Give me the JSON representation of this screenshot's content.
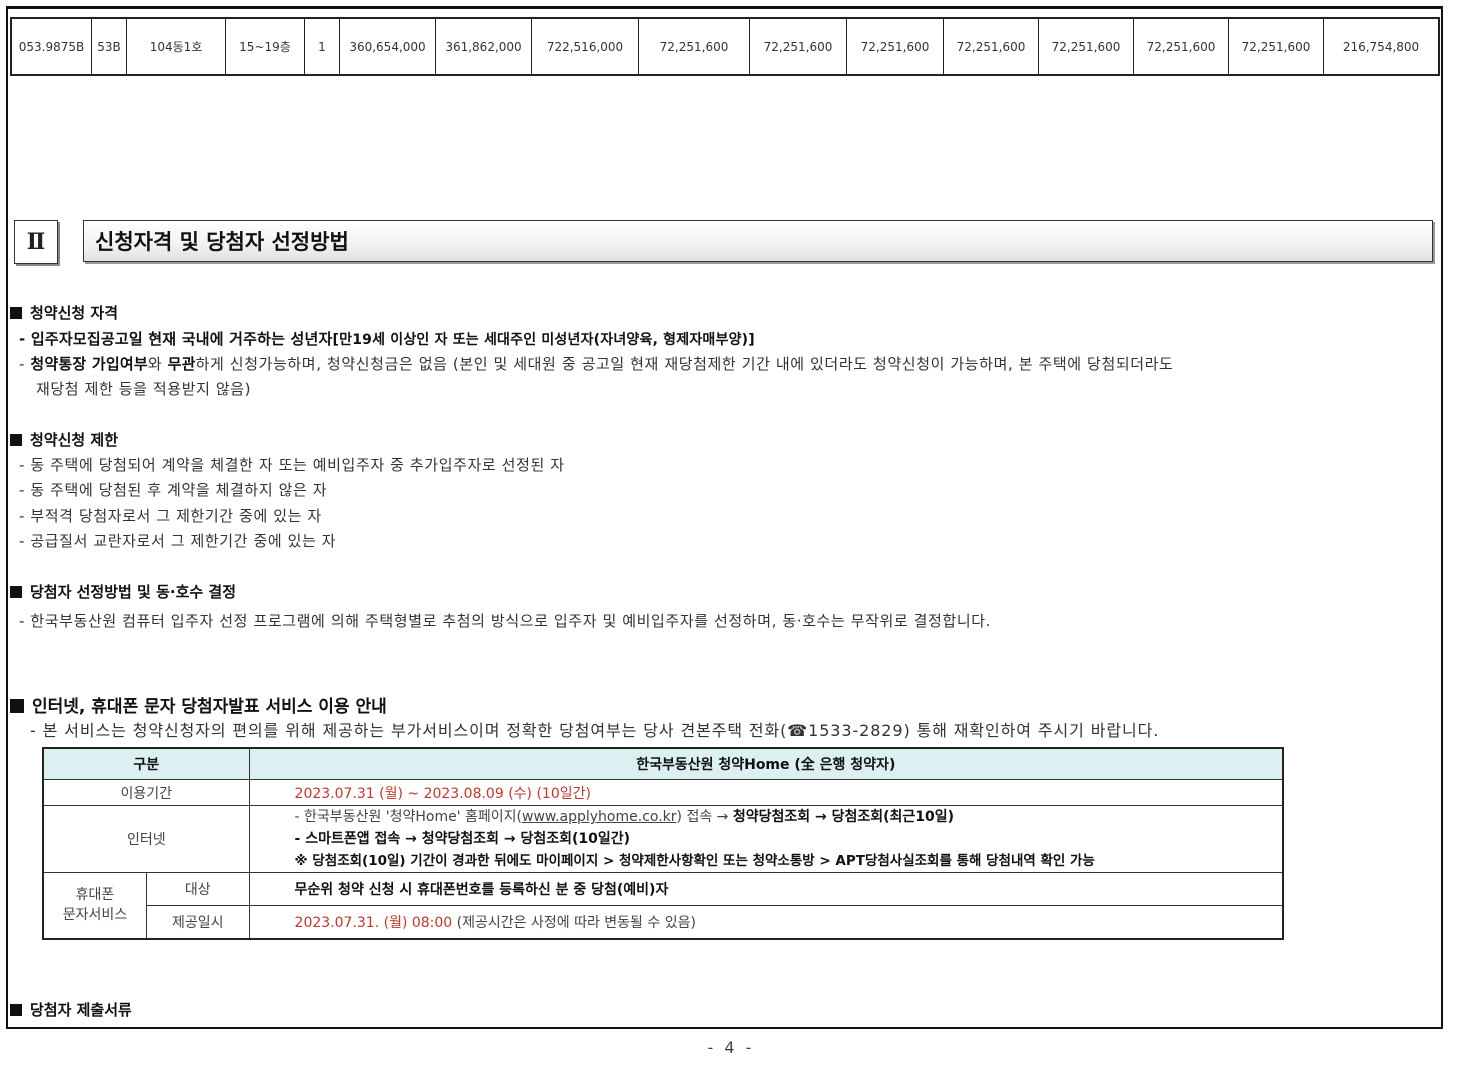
{
  "price_row": [
    "053.9875B",
    "53B",
    "104동1호",
    "15~19층",
    "1",
    "360,654,000",
    "361,862,000",
    "722,516,000",
    "72,251,600",
    "72,251,600",
    "72,251,600",
    "72,251,600",
    "72,251,600",
    "72,251,600",
    "72,251,600",
    "216,754,800"
  ],
  "section": {
    "number": "Ⅱ",
    "title": "신청자격 및 당첨자 선정방법"
  },
  "qualification": {
    "heading": "청약신청 자격",
    "line1_bold": "- 입주자모집공고일 현재 국내에 거주하는 성년자",
    "line1_rest": "[만19세 이상인 자 또는 세대주인 미성년자(자녀양육, 형제자매부양)]",
    "line2_bold_a": "청약통장 가입여부",
    "line2_mid": "와 ",
    "line2_bold_b": "무관",
    "line2_rest": "하게 신청가능하며, 청약신청금은 없음 (본인 및 세대원 중 공고일 현재 재당첨제한 기간 내에 있더라도 청약신청이 가능하며, 본 주택에 당첨되더라도",
    "line3": "재당첨 제한 등을 적용받지 않음)"
  },
  "restriction": {
    "heading": "청약신청 제한",
    "items": [
      "- 동 주택에 당첨되어 계약을 체결한 자 또는 예비입주자 중 추가입주자로 선정된 자",
      "- 동 주택에 당첨된 후 계약을 체결하지 않은 자",
      "- 부적격 당첨자로서 그 제한기간 중에 있는 자",
      "- 공급질서 교란자로서 그 제한기간 중에 있는 자"
    ]
  },
  "selection": {
    "heading": "당첨자 선정방법 및 동·호수 결정",
    "text": "- 한국부동산원 컴퓨터 입주자 선정 프로그램에 의해 주택형별로 추첨의 방식으로 입주자 및 예비입주자를 선정하며, 동·호수는 무작위로 결정합니다."
  },
  "internet": {
    "heading": "인터넷, 휴대폰 문자 당첨자발표 서비스 이용 안내",
    "note": "- 본 서비스는 청약신청자의 편의를 위해 제공하는 부가서비스이며 정확한 당첨여부는 당사 견본주택 전화(☎1533-2829) 통해 재확인하여 주시기 바랍니다.",
    "table": {
      "col1": "구분",
      "col2": "한국부동산원 청약Home (全 은행 청약자)",
      "period_label": "이용기간",
      "period_value": "2023.07.31 (월) ~ 2023.08.09 (수) (10일간)",
      "internet_label": "인터넷",
      "internet_l1_pre": "- 한국부동산원 '청약Home' 홈페이지(",
      "internet_l1_link": "www.applyhome.co.kr",
      "internet_l1_post": ") 접속 → ",
      "internet_l1_bold": "청약당첨조회 → 당첨조회(최근10일)",
      "internet_l2": "- 스마트폰앱 접속 → 청약당첨조회 → 당첨조회(10일간)",
      "internet_l3": "※ 당첨조회(10일) 기간이 경과한 뒤에도 마이페이지 > 청약제한사항확인 또는 청약소통방 > APT당첨사실조회를 통해 당첨내역 확인 가능",
      "sms_label_1": "휴대폰",
      "sms_label_2": "문자서비스",
      "target_label": "대상",
      "target_value": "무순위 청약 신청 시 휴대폰번호를 등록하신 분 중 당첨(예비)자",
      "date_label": "제공일시",
      "date_value_red": "2023.07.31. (월) 08:00",
      "date_value_rest": " (제공시간은 사정에 따라 변동될 수 있음)"
    }
  },
  "documents": {
    "heading": "당첨자 제출서류"
  },
  "page_number": "- 4 -"
}
